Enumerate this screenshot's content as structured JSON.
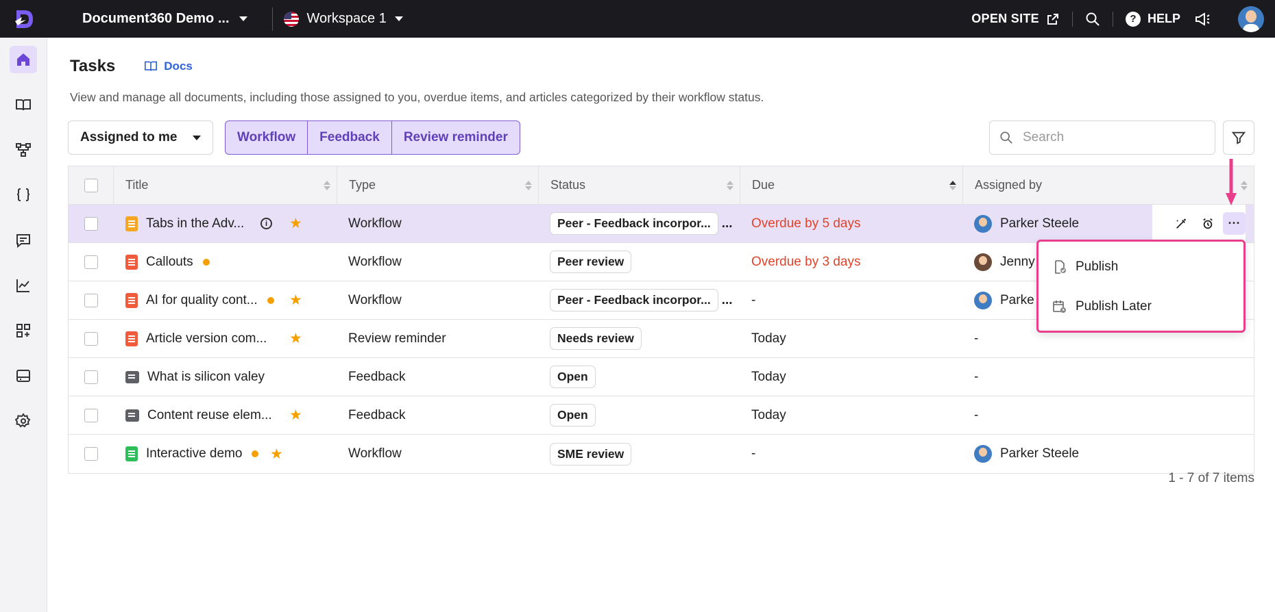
{
  "topbar": {
    "project_name": "Document360 Demo ...",
    "workspace": "Workspace 1",
    "open_site": "OPEN SITE",
    "help": "HELP"
  },
  "sidebar": {
    "items": [
      {
        "icon": "home-icon",
        "active": true
      },
      {
        "icon": "book-icon"
      },
      {
        "icon": "hierarchy-icon"
      },
      {
        "icon": "code-braces-icon"
      },
      {
        "icon": "feedback-icon"
      },
      {
        "icon": "analytics-icon"
      },
      {
        "icon": "apps-icon"
      },
      {
        "icon": "widget-icon"
      },
      {
        "icon": "settings-icon"
      }
    ]
  },
  "page": {
    "title": "Tasks",
    "docs_label": "Docs",
    "description": "View and manage all documents, including those assigned to you, overdue items, and articles categorized by their workflow status."
  },
  "filters": {
    "assigned": "Assigned to me",
    "segments": [
      "Workflow",
      "Feedback",
      "Review reminder"
    ],
    "search_placeholder": "Search"
  },
  "table": {
    "headers": [
      "Title",
      "Type",
      "Status",
      "Due",
      "Assigned by"
    ],
    "rows": [
      {
        "title": "Tabs in the Adv...",
        "icon": "article-icon-orange",
        "info": true,
        "starred": true,
        "dot": false,
        "type": "Workflow",
        "status": "Peer - Feedback incorpor...",
        "status_more": "...",
        "due": "Overdue by 5 days",
        "due_overdue": true,
        "assigned_by": "Parker Steele"
      },
      {
        "title": "Callouts",
        "icon": "article-icon-red",
        "starred": false,
        "dot": true,
        "type": "Workflow",
        "status": "Peer review",
        "due": "Overdue by 3 days",
        "due_overdue": true,
        "assigned_by": "Jenny"
      },
      {
        "title": "AI for quality cont...",
        "icon": "article-icon-red",
        "starred": true,
        "dot": true,
        "type": "Workflow",
        "status": "Peer - Feedback incorpor...",
        "status_more": "...",
        "due": "-",
        "assigned_by": "Parke"
      },
      {
        "title": "Article version com...",
        "icon": "article-icon-red",
        "starred": true,
        "dot": false,
        "type": "Review reminder",
        "status": "Needs review",
        "due": "Today",
        "assigned_by": "-"
      },
      {
        "title": "What is silicon valey",
        "icon": "feedback-icon",
        "starred": false,
        "dot": false,
        "type": "Feedback",
        "status": "Open",
        "due": "Today",
        "assigned_by": "-"
      },
      {
        "title": "Content reuse elem...",
        "icon": "feedback-icon",
        "starred": true,
        "dot": false,
        "type": "Feedback",
        "status": "Open",
        "due": "Today",
        "assigned_by": "-"
      },
      {
        "title": "Interactive demo",
        "icon": "article-icon-green",
        "starred": true,
        "dot": true,
        "type": "Workflow",
        "status": "SME review",
        "due": "-",
        "assigned_by": "Parker Steele"
      }
    ],
    "pager": "1 - 7 of 7 items"
  },
  "menu": {
    "items": [
      "Publish",
      "Publish Later"
    ]
  },
  "colors": {
    "accent": "#6040b8",
    "overdue": "#e0442c",
    "highlight": "#e83e8c"
  }
}
